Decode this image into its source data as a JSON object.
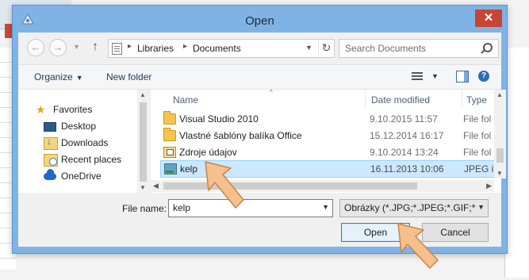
{
  "dialog": {
    "title": "Open",
    "close_glyph": "✕"
  },
  "navigation": {
    "back_glyph": "←",
    "forward_glyph": "→",
    "up_glyph": "↑",
    "breadcrumb": [
      "Libraries",
      "Documents"
    ],
    "breadcrumb_separator": "▸",
    "search_placeholder": "Search Documents"
  },
  "toolbar": {
    "organize_label": "Organize",
    "new_folder_label": "New folder"
  },
  "sidebar": {
    "items": [
      {
        "label": "Favorites",
        "icon": "star-icon"
      },
      {
        "label": "Desktop",
        "icon": "desktop-icon"
      },
      {
        "label": "Downloads",
        "icon": "downloads-icon"
      },
      {
        "label": "Recent places",
        "icon": "recent-places-icon"
      },
      {
        "label": "OneDrive",
        "icon": "onedrive-icon"
      }
    ]
  },
  "file_list": {
    "columns": [
      "Name",
      "Date modified",
      "Type"
    ],
    "rows": [
      {
        "name": "Visual Studio 2010",
        "date": "9.10.2015 11:57",
        "type": "File fol",
        "icon": "folder-icon"
      },
      {
        "name": "Vlastné šablóny balíka Office",
        "date": "15.12.2014 16:17",
        "type": "File fol",
        "icon": "folder-icon"
      },
      {
        "name": "Zdroje údajov",
        "date": "9.10.2014 13:24",
        "type": "File fol",
        "icon": "data-sources-folder-icon"
      },
      {
        "name": "kelp",
        "date": "16.11.2013 10:06",
        "type": "JPEG im",
        "icon": "jpeg-image-icon",
        "selected": true
      }
    ]
  },
  "footer": {
    "file_name_label": "File name:",
    "file_name_value": "kelp",
    "filter_value": "Obrázky (*.JPG;*.JPEG;*.GIF;*.PNG)",
    "open_label": "Open",
    "cancel_label": "Cancel"
  },
  "colors": {
    "frame": "#7fb3e6",
    "close": "#c74535",
    "selection": "#cce8ff",
    "callout_arrow": "#f6c08e"
  }
}
